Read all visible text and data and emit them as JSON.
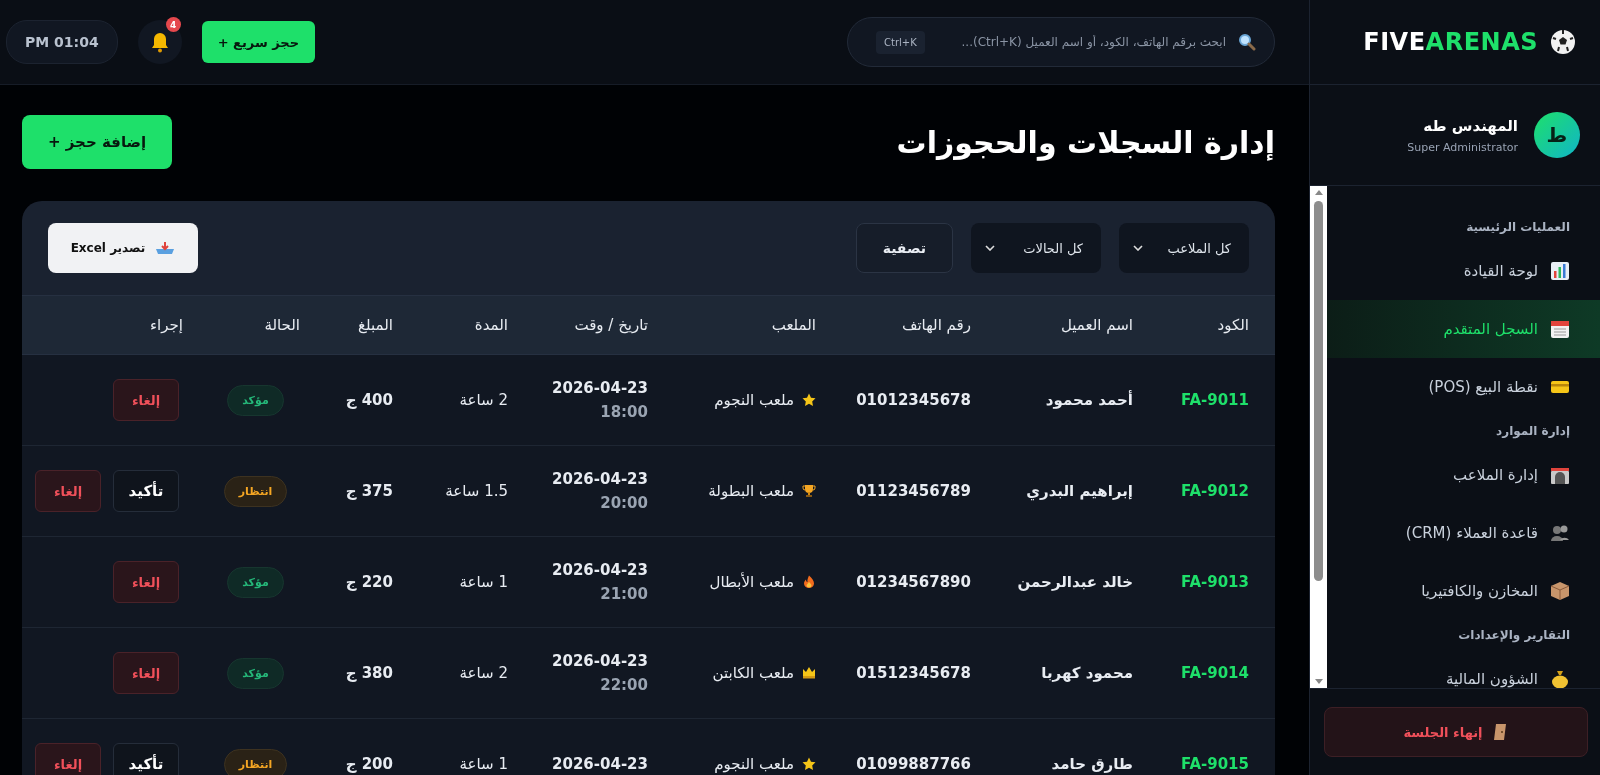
{
  "top_bar": {
    "clock": "PM 01:04",
    "notification_count": "4",
    "quick_booking": "حجز سريع +",
    "search": {
      "placeholder": "ابحث برقم الهاتف، الكود، أو اسم العميل (Ctrl+K)...",
      "shortcut": "Ctrl+K"
    }
  },
  "sidebar": {
    "logo": {
      "part_1": "FIVE",
      "part_2": "ARENAS"
    },
    "profile": {
      "initial": "ط",
      "name": "المهندس طه",
      "role": "Super Administrator"
    },
    "sections": [
      {
        "title": "العمليات الرئيسية",
        "items": [
          {
            "label": "لوحة القيادة",
            "selected": false
          },
          {
            "label": "السجل المتقدم",
            "selected": true
          },
          {
            "label": "نقطة البيع (POS)",
            "selected": false
          }
        ]
      },
      {
        "title": "إدارة الموارد",
        "items": [
          {
            "label": "إدارة الملاعب",
            "selected": false
          },
          {
            "label": "قاعدة العملاء (CRM)",
            "selected": false
          },
          {
            "label": "المخازن والكافتيريا",
            "selected": false
          }
        ]
      },
      {
        "title": "التقارير والإعدادات",
        "items": [
          {
            "label": "الشؤون المالية",
            "selected": false
          }
        ]
      }
    ],
    "logout": "إنهاء الجلسة"
  },
  "page": {
    "title": "إدارة السجلات والحجوزات",
    "add_button": "إضافة حجز +"
  },
  "filters": {
    "stadium_select": "كل الملاعب",
    "status_select": "كل الحالات",
    "filter_button": "تصفية",
    "export_button": "تصدير Excel"
  },
  "table": {
    "columns": [
      "الكود",
      "اسم العميل",
      "رقم الهاتف",
      "الملعب",
      "تاريخ / وقت",
      "المدة",
      "المبلغ",
      "الحالة",
      "إجراء"
    ],
    "rows": [
      {
        "code": "FA-9011",
        "customer": "أحمد محمود",
        "phone": "01012345678",
        "stadium": "ملعب النجوم",
        "date": "2026-04-23",
        "time": "18:00",
        "duration": "2 ساعة",
        "amount": "400 ج",
        "status": {
          "kind": "confirmed",
          "label": "مؤكد"
        },
        "actions": [
          {
            "kind": "cancel",
            "label": "إلغاء"
          }
        ]
      },
      {
        "code": "FA-9012",
        "customer": "إبراهيم البدري",
        "phone": "01123456789",
        "stadium": "ملعب البطولة",
        "date": "2026-04-23",
        "time": "20:00",
        "duration": "1.5 ساعة",
        "amount": "375 ج",
        "status": {
          "kind": "pending",
          "label": "انتظار"
        },
        "actions": [
          {
            "kind": "confirm",
            "label": "تأكيد"
          },
          {
            "kind": "cancel",
            "label": "إلغاء"
          }
        ]
      },
      {
        "code": "FA-9013",
        "customer": "خالد عبدالرحمن",
        "phone": "01234567890",
        "stadium": "ملعب الأبطال",
        "date": "2026-04-23",
        "time": "21:00",
        "duration": "1 ساعة",
        "amount": "220 ج",
        "status": {
          "kind": "confirmed",
          "label": "مؤكد"
        },
        "actions": [
          {
            "kind": "cancel",
            "label": "إلغاء"
          }
        ]
      },
      {
        "code": "FA-9014",
        "customer": "محمود كهربا",
        "phone": "01512345678",
        "stadium": "ملعب الكابتن",
        "date": "2026-04-23",
        "time": "22:00",
        "duration": "2 ساعة",
        "amount": "380 ج",
        "status": {
          "kind": "confirmed",
          "label": "مؤكد"
        },
        "actions": [
          {
            "kind": "cancel",
            "label": "إلغاء"
          }
        ]
      },
      {
        "code": "FA-9015",
        "customer": "طارق حامد",
        "phone": "01099887766",
        "stadium": "ملعب النجوم",
        "date": "2026-04-23",
        "duration": "1 ساعة",
        "amount": "200 ج",
        "status": {
          "kind": "pending",
          "label": "انتظار"
        },
        "actions": [
          {
            "kind": "confirm",
            "label": "تأكيد"
          },
          {
            "kind": "cancel",
            "label": "إلغاء"
          }
        ]
      }
    ]
  }
}
